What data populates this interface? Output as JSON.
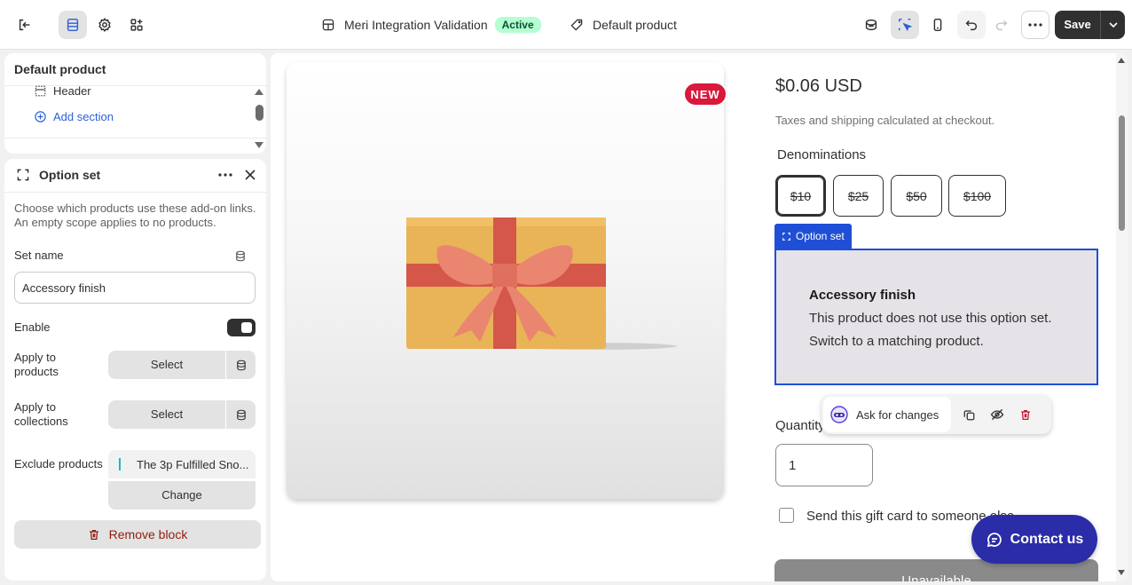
{
  "topbar": {
    "exit_icon": "exit-icon",
    "sections_icon": "sections-icon",
    "settings_icon": "gear-icon",
    "apps_icon": "apps-icon",
    "theme_name": "Meri Integration Validation",
    "theme_status": "Active",
    "template_name": "Default product",
    "save_label": "Save"
  },
  "sidebar": {
    "title": "Default product",
    "sections": [
      {
        "label": "Header",
        "icon": "header-icon"
      },
      {
        "label": "Add section",
        "icon": "plus-circle-icon"
      }
    ]
  },
  "block": {
    "title": "Option set",
    "description": "Choose which products use these add-on links. An empty scope applies to no products.",
    "set_name_label": "Set name",
    "set_name_value": "Accessory finish",
    "enable_label": "Enable",
    "enable_value": true,
    "apply_products_label": "Apply to products",
    "apply_collections_label": "Apply to collections",
    "select_label": "Select",
    "exclude_label": "Exclude products",
    "excluded_product": "The 3p Fulfilled Sno...",
    "change_label": "Change",
    "remove_label": "Remove block"
  },
  "preview": {
    "new_badge": "NEW",
    "price": "$0.06 USD",
    "tax_note": "Taxes and shipping calculated at checkout.",
    "denominations_label": "Denominations",
    "denominations": [
      "$10",
      "$25",
      "$50",
      "$100"
    ],
    "selected_denomination": "$10",
    "option_set_tag": "Option set",
    "option_set_title": "Accessory finish",
    "option_set_line1": "This product does not use this option set.",
    "option_set_line2": "Switch to a matching product.",
    "ask_changes_label": "Ask for changes",
    "quantity_label": "Quantity",
    "quantity_value": "1",
    "gift_label": "Send this gift card to someone else",
    "unavailable_label": "Unavailable",
    "contact_label": "Contact us"
  },
  "colors": {
    "accent_blue": "#1f4fd6",
    "active_badge_bg": "#b4fed2",
    "new_badge": "#d9183d",
    "contact_btn": "#2b2ca8",
    "remove_text": "#8e1f0b"
  }
}
